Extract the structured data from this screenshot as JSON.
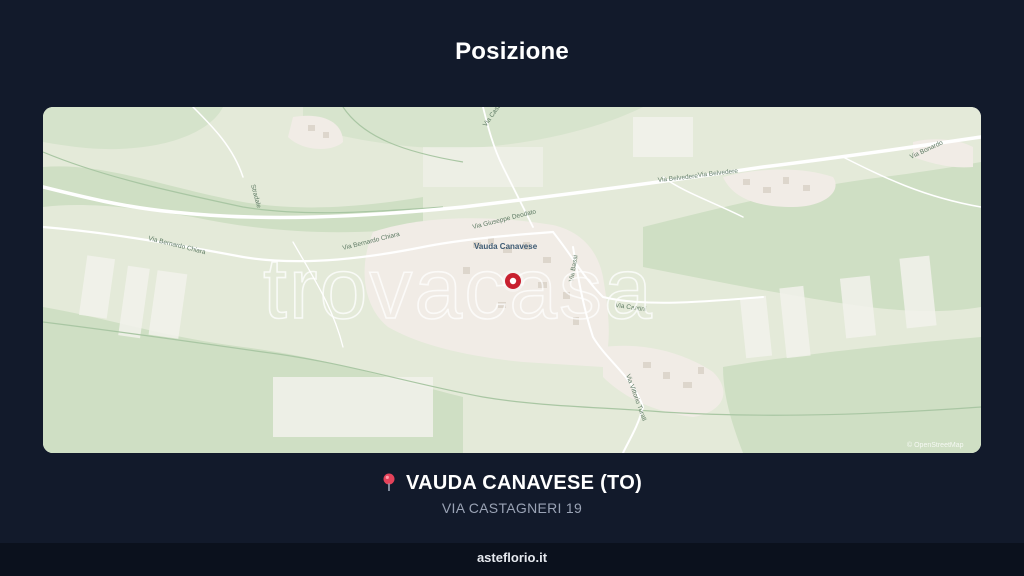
{
  "section_title": "Posizione",
  "map": {
    "town_label": "Vauda Canavese",
    "watermark": "trovacasa",
    "attribution": "© OpenStreetMap",
    "road_labels": {
      "via_belvedere_1": "Via Belvedere",
      "via_belvedere_2": "Via Belvedere",
      "via_bernardo_chiara": "Via Bernardo Chiara",
      "via_bernardo_chiara_2": "Via Bernardo Chiara",
      "via_giuseppe_deodato": "Via Giuseppe Deodato",
      "via_castello": "Via Castello",
      "via_bassi": "Via Bassi",
      "via_cantini": "Via Cantini",
      "via_vittorio_turati": "Via Vittorio Turati",
      "via_bonardo": "Via Bonardo",
      "stradale": "Stradale"
    },
    "colors": {
      "land": "#e4ead9",
      "forest": "#cfdfc4",
      "urban": "#f1ece6",
      "marker": "#c8202f"
    },
    "icon": "location-marker-icon"
  },
  "location": {
    "icon": "round-pushpin-icon",
    "town": "VAUDA CANAVESE (TO)",
    "address": "VIA CASTAGNERI 19"
  },
  "footer": {
    "brand": "asteflorio.it"
  }
}
